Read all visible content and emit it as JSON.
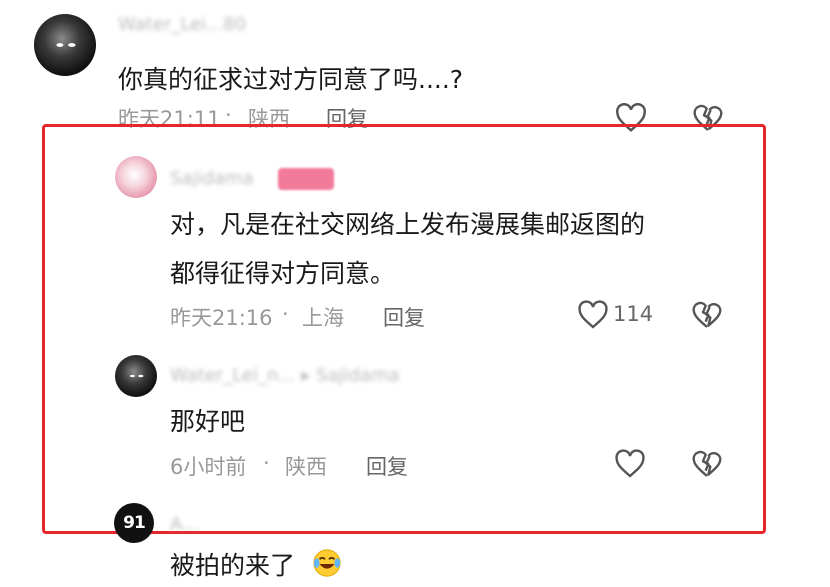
{
  "comments": [
    {
      "username": "Water_Lei...80",
      "text": "你真的征求过对方同意了吗....?",
      "time": "昨天21:11",
      "separator": "·",
      "location": "陕西",
      "reply_label": "回复"
    },
    {
      "username": "Sajidama",
      "text_line1": "对，凡是在社交网络上发布漫展集邮返图的",
      "text_line2": "都得征得对方同意。",
      "time": "昨天21:16",
      "separator": "·",
      "location": "上海",
      "reply_label": "回复",
      "like_count": "114"
    },
    {
      "username": "Water_Lei_n... ▸ Sajidama",
      "text": "那好吧",
      "time": "6小时前",
      "separator": "·",
      "location": "陕西",
      "reply_label": "回复"
    },
    {
      "username": "A...",
      "avatar_text": "91",
      "text": "被拍的来了"
    }
  ],
  "icons": [
    "heart-icon",
    "broken-heart-icon",
    "laughing-crying-emoji"
  ],
  "colors": {
    "highlight_box": "#e6262b",
    "meta_text": "#999999",
    "main_text": "#1a1a1a"
  }
}
